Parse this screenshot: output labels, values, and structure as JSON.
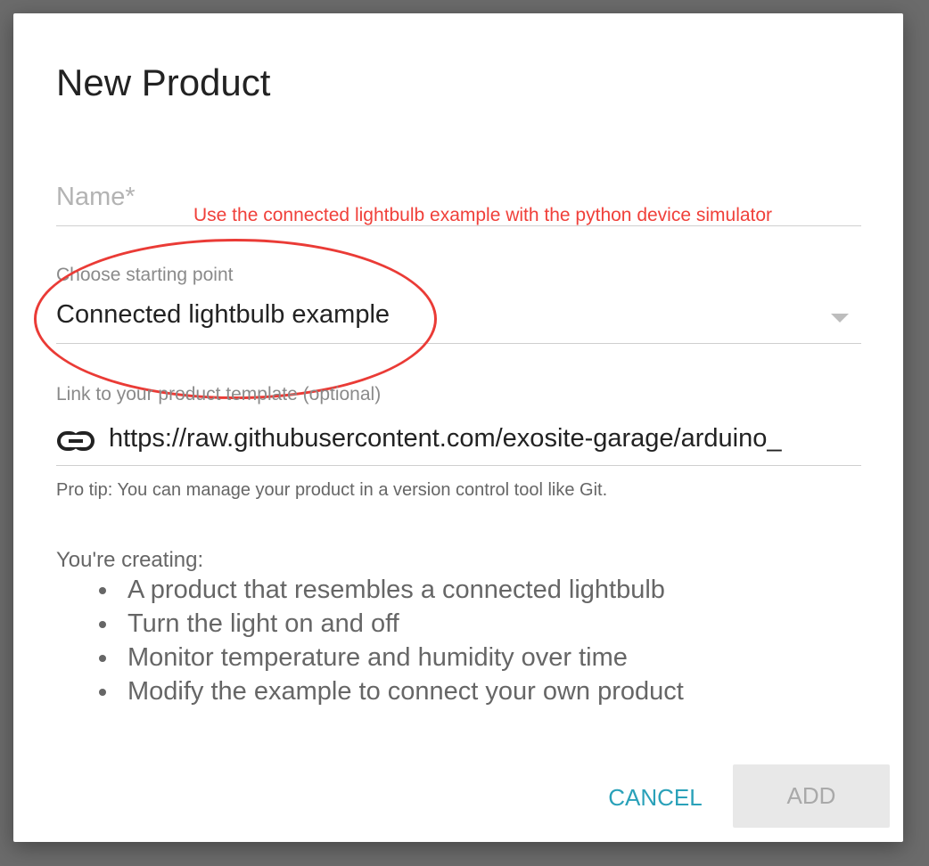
{
  "dialog": {
    "title": "New Product",
    "name_placeholder": "Name*",
    "annotation_note": "Use the connected lightbulb example with the python device simulator",
    "starting_point": {
      "label": "Choose starting point",
      "value": "Connected lightbulb example"
    },
    "template_link": {
      "label": "Link to your product template (optional)",
      "value": "https://raw.githubusercontent.com/exosite-garage/arduino_",
      "icon": "link-icon"
    },
    "pro_tip": "Pro tip: You can manage your product in a version control tool like Git.",
    "creating": {
      "title": "You're creating:",
      "items": [
        "A product that resembles a connected lightbulb",
        "Turn the light on and off",
        "Monitor temperature and humidity over time",
        "Modify the example to connect your own product"
      ]
    },
    "actions": {
      "cancel_label": "CANCEL",
      "add_label": "ADD"
    }
  },
  "colors": {
    "accent": "#2aa1b9",
    "annotation": "#ea3b36",
    "disabled_button": "#e8e8e8"
  }
}
